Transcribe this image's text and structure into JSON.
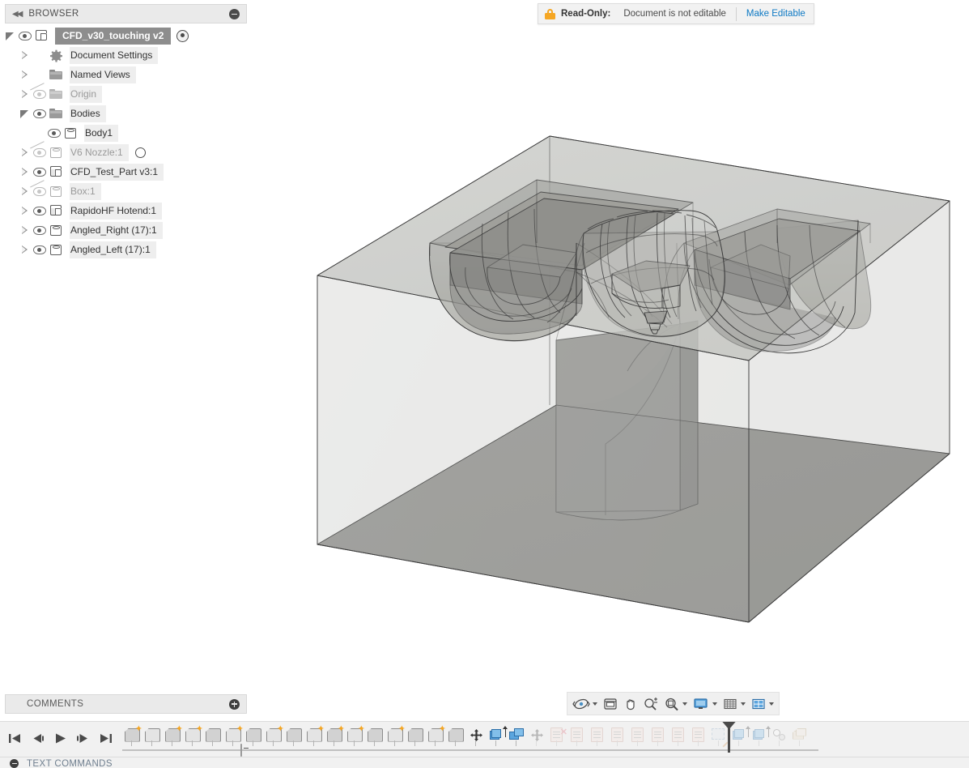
{
  "app": {
    "background_color": "#ffffff",
    "panel_bg": "#eaeaea"
  },
  "browser": {
    "header_title": "BROWSER",
    "collapse_glyph": "◀◀",
    "minimize_icon": "minus-circle-icon",
    "items": [
      {
        "label": "CFD_v30_touching v2",
        "icon": "component-icon",
        "twisty": "open",
        "eye": "visible",
        "indent": 0,
        "root": true,
        "trailing": "radio"
      },
      {
        "label": "Document Settings",
        "icon": "gear-icon",
        "twisty": "closed",
        "eye": "none",
        "indent": 1,
        "root": false,
        "trailing": "none"
      },
      {
        "label": "Named Views",
        "icon": "folder-icon",
        "twisty": "closed",
        "eye": "none",
        "indent": 1,
        "root": false,
        "trailing": "none"
      },
      {
        "label": "Origin",
        "icon": "folder-icon",
        "twisty": "closed",
        "eye": "hidden",
        "indent": 1,
        "root": false,
        "trailing": "none"
      },
      {
        "label": "Bodies",
        "icon": "folder-icon",
        "twisty": "open",
        "eye": "visible",
        "indent": 1,
        "root": false,
        "trailing": "none"
      },
      {
        "label": "Body1",
        "icon": "body-icon",
        "twisty": "none",
        "eye": "visible",
        "indent": 2,
        "root": false,
        "trailing": "none"
      },
      {
        "label": "V6 Nozzle:1",
        "icon": "body-icon",
        "twisty": "closed",
        "eye": "hidden",
        "indent": 1,
        "root": false,
        "trailing": "ring"
      },
      {
        "label": "CFD_Test_Part v3:1",
        "icon": "component-icon",
        "twisty": "closed",
        "eye": "visible",
        "indent": 1,
        "root": false,
        "trailing": "none"
      },
      {
        "label": "Box:1",
        "icon": "body-icon",
        "twisty": "closed",
        "eye": "hidden",
        "indent": 1,
        "root": false,
        "trailing": "none"
      },
      {
        "label": "RapidoHF Hotend:1",
        "icon": "component-icon",
        "twisty": "closed",
        "eye": "visible",
        "indent": 1,
        "root": false,
        "trailing": "none"
      },
      {
        "label": "Angled_Right (17):1",
        "icon": "body-icon",
        "twisty": "closed",
        "eye": "visible",
        "indent": 1,
        "root": false,
        "trailing": "none"
      },
      {
        "label": "Angled_Left (17):1",
        "icon": "body-icon",
        "twisty": "closed",
        "eye": "visible",
        "indent": 1,
        "root": false,
        "trailing": "none"
      }
    ]
  },
  "readonly": {
    "lock_icon": "lock-icon",
    "label": "Read-Only:",
    "message": "Document is not editable",
    "action": "Make Editable",
    "link_color": "#0d79c4",
    "lock_color": "#f5a623"
  },
  "comments": {
    "title": "COMMENTS",
    "add_icon": "plus-circle-icon"
  },
  "navbar": {
    "buttons": [
      {
        "name": "orbit-icon",
        "has_caret": true
      },
      {
        "name": "look-at-icon",
        "has_caret": false
      },
      {
        "name": "pan-hand-icon",
        "has_caret": false
      },
      {
        "name": "zoom-in-out-icon",
        "has_caret": false
      },
      {
        "name": "fit-magnifier-icon",
        "has_caret": true
      },
      {
        "name": "display-settings-monitor-icon",
        "has_caret": true
      },
      {
        "name": "grid-snaps-icon",
        "has_caret": true
      },
      {
        "name": "viewport-layout-icon",
        "has_caret": true
      }
    ]
  },
  "timeline": {
    "playback": [
      {
        "name": "go-to-beginning-button",
        "glyph": "first"
      },
      {
        "name": "step-backward-button",
        "glyph": "prev"
      },
      {
        "name": "play-button",
        "glyph": "play"
      },
      {
        "name": "step-forward-button",
        "glyph": "next"
      },
      {
        "name": "go-to-end-button",
        "glyph": "last"
      }
    ],
    "zoom_handle": "timeline-zoom-handle",
    "playhead": "timeline-marker",
    "playhead_index": 30,
    "features": [
      {
        "kind": "feature",
        "star": true,
        "faded": false
      },
      {
        "kind": "feature",
        "star": false,
        "faded": false
      },
      {
        "kind": "feature",
        "star": true,
        "faded": false
      },
      {
        "kind": "feature",
        "star": true,
        "faded": false
      },
      {
        "kind": "feature",
        "star": false,
        "faded": false
      },
      {
        "kind": "feature",
        "star": true,
        "faded": false
      },
      {
        "kind": "feature",
        "star": false,
        "faded": false
      },
      {
        "kind": "feature",
        "star": true,
        "faded": false
      },
      {
        "kind": "feature",
        "star": false,
        "faded": false
      },
      {
        "kind": "feature",
        "star": true,
        "faded": false
      },
      {
        "kind": "feature",
        "star": true,
        "faded": false
      },
      {
        "kind": "feature",
        "star": true,
        "faded": false
      },
      {
        "kind": "feature",
        "star": false,
        "faded": false
      },
      {
        "kind": "feature",
        "star": true,
        "faded": false
      },
      {
        "kind": "feature",
        "star": false,
        "faded": false
      },
      {
        "kind": "feature",
        "star": true,
        "faded": false
      },
      {
        "kind": "feature",
        "star": false,
        "faded": false
      },
      {
        "kind": "move",
        "star": false,
        "faded": false
      },
      {
        "kind": "extrude",
        "star": false,
        "faded": false
      },
      {
        "kind": "combine",
        "star": false,
        "faded": false
      },
      {
        "kind": "move",
        "star": false,
        "faded": true
      },
      {
        "kind": "sketch-x",
        "star": false,
        "faded": true
      },
      {
        "kind": "sketch",
        "star": false,
        "faded": true
      },
      {
        "kind": "sketch",
        "star": false,
        "faded": true
      },
      {
        "kind": "sketch",
        "star": false,
        "faded": true
      },
      {
        "kind": "sketch",
        "star": false,
        "faded": true
      },
      {
        "kind": "sketch",
        "star": false,
        "faded": true
      },
      {
        "kind": "sketch",
        "star": false,
        "faded": true
      },
      {
        "kind": "sketch",
        "star": false,
        "faded": true
      },
      {
        "kind": "plane",
        "star": false,
        "faded": true
      },
      {
        "kind": "extrude",
        "star": false,
        "faded": true
      },
      {
        "kind": "extrude",
        "star": false,
        "faded": true
      },
      {
        "kind": "revolve",
        "star": false,
        "faded": true
      },
      {
        "kind": "shell",
        "star": false,
        "faded": true
      }
    ]
  },
  "textcommands": {
    "title": "TEXT COMMANDS",
    "toggle_icon": "minus-circle-icon"
  },
  "model": {
    "description": "Translucent CFD air-volume box with cooling ducts and hotend heatsink",
    "colors": {
      "top_face": "#c9cac6",
      "left_face": "#c4c5c2",
      "floor_face": "#8d8d8a",
      "inner_shade": "#9a9a97",
      "edge": "#3c3c3c"
    }
  }
}
